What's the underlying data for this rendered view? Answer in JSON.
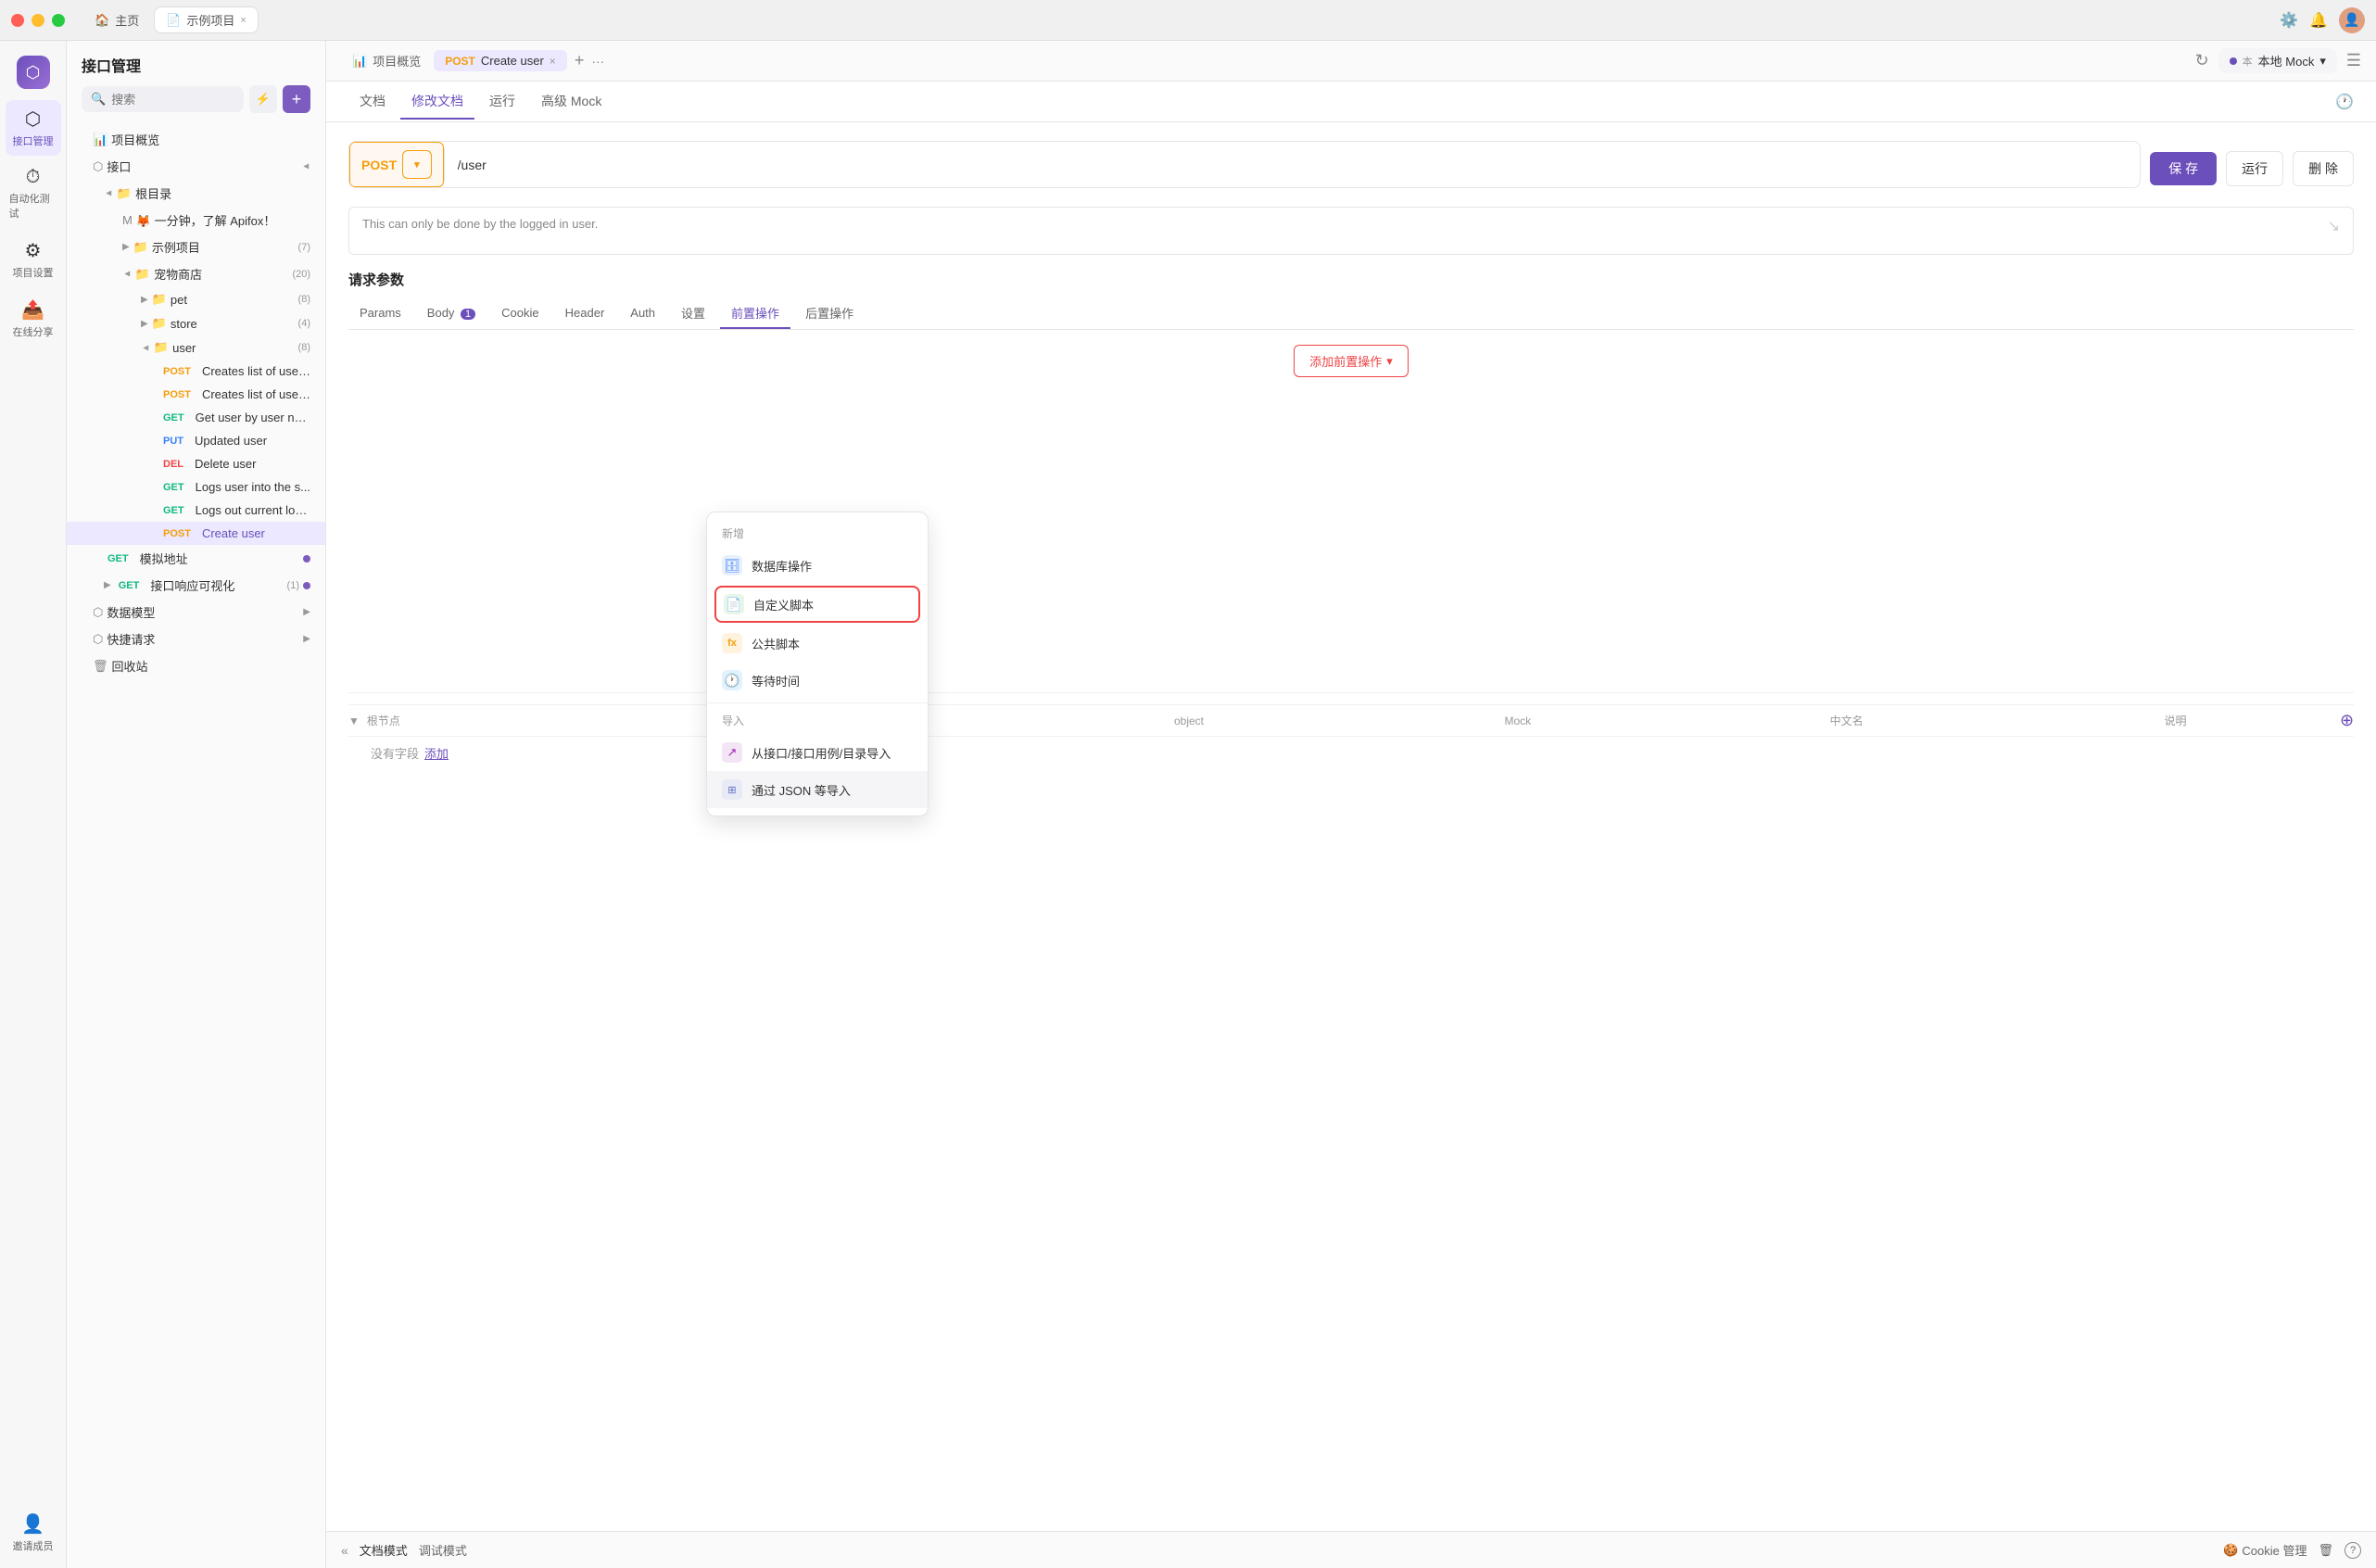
{
  "titlebar": {
    "home_label": "主页",
    "tab_label": "示例项目",
    "tab_close": "×",
    "settings_icon": "⚙",
    "bell_icon": "🔔",
    "hamburger": "☰"
  },
  "icon_sidebar": {
    "items": [
      {
        "id": "api-management",
        "icon": "⬡",
        "label": "接口管理",
        "active": true
      },
      {
        "id": "automation",
        "icon": "⏱",
        "label": "自动化测试",
        "active": false
      },
      {
        "id": "project-settings",
        "icon": "⚙",
        "label": "项目设置",
        "active": false
      },
      {
        "id": "online-share",
        "icon": "📤",
        "label": "在线分享",
        "active": false
      },
      {
        "id": "invite-members",
        "icon": "👤",
        "label": "邀请成员",
        "active": false
      }
    ]
  },
  "tree_sidebar": {
    "title": "接口管理",
    "search_placeholder": "搜索",
    "items": [
      {
        "id": "overview",
        "label": "项目概览",
        "icon": "📊",
        "indent": 0,
        "type": "overview"
      },
      {
        "id": "interface",
        "label": "接口",
        "icon": "▼",
        "indent": 0,
        "type": "section"
      },
      {
        "id": "root",
        "label": "根目录",
        "icon": "📁",
        "indent": 1,
        "type": "folder"
      },
      {
        "id": "apifox-intro",
        "label": "🦊 一分钟，了解 Apifox！",
        "icon": "M",
        "indent": 2,
        "type": "doc"
      },
      {
        "id": "example-project",
        "label": "示例项目",
        "count": "(7)",
        "icon": "▶",
        "indent": 2,
        "type": "folder-collapsed"
      },
      {
        "id": "pet-store",
        "label": "宠物商店",
        "count": "(20)",
        "icon": "▼",
        "indent": 2,
        "type": "folder-open"
      },
      {
        "id": "pet",
        "label": "pet",
        "count": "(8)",
        "icon": "▶",
        "indent": 3,
        "type": "folder-collapsed"
      },
      {
        "id": "store",
        "label": "store",
        "count": "(4)",
        "icon": "▶",
        "indent": 3,
        "type": "folder-collapsed"
      },
      {
        "id": "user",
        "label": "user",
        "count": "(8)",
        "icon": "▼",
        "indent": 3,
        "type": "folder-open"
      },
      {
        "id": "creates-list-1",
        "method": "POST",
        "label": "Creates list of users ...",
        "indent": 4,
        "type": "api",
        "method_type": "post"
      },
      {
        "id": "creates-list-2",
        "method": "POST",
        "label": "Creates list of users ...",
        "indent": 4,
        "type": "api",
        "method_type": "post"
      },
      {
        "id": "get-user",
        "method": "GET",
        "label": "Get user by user na...",
        "indent": 4,
        "type": "api",
        "method_type": "get"
      },
      {
        "id": "update-user",
        "method": "PUT",
        "label": "Updated user",
        "indent": 4,
        "type": "api",
        "method_type": "put"
      },
      {
        "id": "delete-user",
        "method": "DEL",
        "label": "Delete user",
        "indent": 4,
        "type": "api",
        "method_type": "del"
      },
      {
        "id": "logs-into",
        "method": "GET",
        "label": "Logs user into the s...",
        "indent": 4,
        "type": "api",
        "method_type": "get"
      },
      {
        "id": "logs-out",
        "method": "GET",
        "label": "Logs out current log...",
        "indent": 4,
        "type": "api",
        "method_type": "get"
      },
      {
        "id": "create-user",
        "method": "POST",
        "label": "Create user",
        "indent": 4,
        "type": "api",
        "method_type": "post",
        "active": true
      },
      {
        "id": "mock-addr",
        "method": "GET",
        "label": "模拟地址",
        "indent": 1,
        "type": "api",
        "method_type": "get",
        "has_dot": true
      },
      {
        "id": "api-response-viz",
        "method": "GET",
        "label": "接口响应可视化",
        "count": "(1)",
        "icon": "▶",
        "indent": 1,
        "type": "folder-collapsed",
        "has_dot": true
      },
      {
        "id": "data-model",
        "label": "数据模型",
        "icon": "▶",
        "indent": 0,
        "type": "section"
      },
      {
        "id": "quick-request",
        "label": "快捷请求",
        "icon": "▶",
        "indent": 0,
        "type": "section"
      },
      {
        "id": "recycle",
        "label": "回收站",
        "icon": "🗑",
        "indent": 0,
        "type": "recycle"
      }
    ]
  },
  "content_tabs": {
    "project_overview": "项目概览",
    "current_tab_method": "POST",
    "current_tab_name": "Create user",
    "plus_icon": "+",
    "more_icon": "···"
  },
  "sub_tabs": {
    "items": [
      {
        "id": "doc",
        "label": "文档"
      },
      {
        "id": "edit-doc",
        "label": "修改文档",
        "active": true
      },
      {
        "id": "run",
        "label": "运行"
      },
      {
        "id": "advanced-mock",
        "label": "高级 Mock"
      }
    ]
  },
  "api_editor": {
    "method": "POST",
    "url": "/user",
    "description": "This can only be done by the logged in user.",
    "save_btn": "保 存",
    "run_btn": "运行",
    "delete_btn": "删 除"
  },
  "request_params": {
    "section_title": "请求参数",
    "tabs": [
      {
        "id": "params",
        "label": "Params"
      },
      {
        "id": "body",
        "label": "Body",
        "badge": "1"
      },
      {
        "id": "cookie",
        "label": "Cookie"
      },
      {
        "id": "header",
        "label": "Header"
      },
      {
        "id": "auth",
        "label": "Auth"
      },
      {
        "id": "settings",
        "label": "设置"
      },
      {
        "id": "pre-op",
        "label": "前置操作",
        "active": true
      },
      {
        "id": "post-op",
        "label": "后置操作"
      }
    ],
    "add_op_btn": "添加前置操作"
  },
  "dropdown": {
    "new_section": "新增",
    "items_new": [
      {
        "id": "db-op",
        "label": "数据库操作",
        "icon": "🗄",
        "icon_class": "di-db"
      },
      {
        "id": "custom-script",
        "label": "自定义脚本",
        "icon": "📄",
        "icon_class": "di-script",
        "selected": true
      },
      {
        "id": "public-script",
        "label": "公共脚本",
        "icon": "fx",
        "icon_class": "di-public"
      },
      {
        "id": "wait-time",
        "label": "等待时间",
        "icon": "🕐",
        "icon_class": "di-wait"
      }
    ],
    "import_section": "导入",
    "items_import": [
      {
        "id": "import-from-api",
        "label": "从接口/接口用例/目录导入",
        "icon": "↗",
        "icon_class": "di-import"
      },
      {
        "id": "import-json",
        "label": "通过 JSON 等导入",
        "icon": "⊞"
      }
    ]
  },
  "body_section": {
    "columns": {
      "name": "根节点",
      "type": "object",
      "mock": "Mock",
      "zh_name": "中文名",
      "description": "说明"
    },
    "empty_msg": "没有字段",
    "add_link": "添加"
  },
  "bottom_bar": {
    "doc_mode": "文档模式",
    "debug_mode": "调试模式",
    "cookie_mgr": "Cookie 管理",
    "help_icon": "?"
  },
  "top_right": {
    "mock_label": "本地 Mock",
    "refresh_icon": "↻"
  }
}
